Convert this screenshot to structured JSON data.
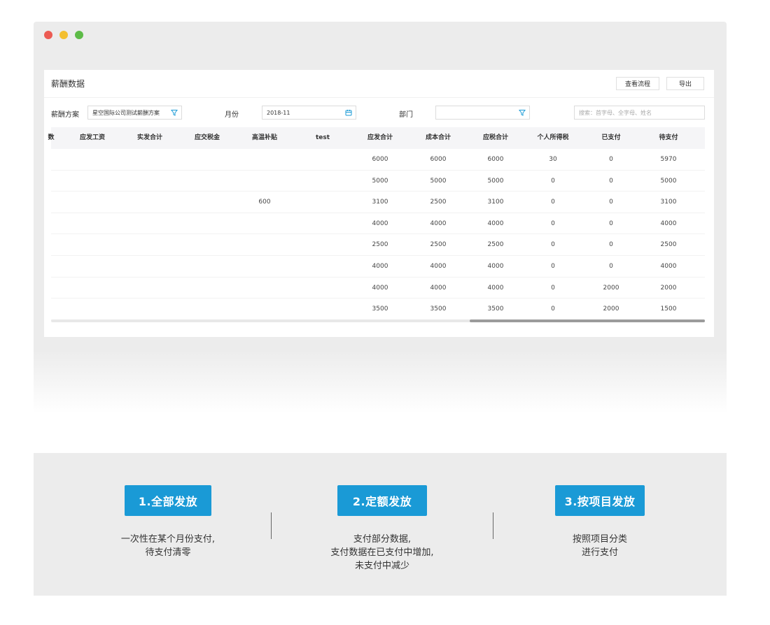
{
  "window": {
    "dots": [
      "#ec5b53",
      "#f3bf2f",
      "#5dbb47"
    ],
    "panel": {
      "title": "薪酬数据",
      "buttons": {
        "view_flow": "查看流程",
        "export": "导出"
      },
      "filters": {
        "plan_label": "薪酬方案",
        "plan_value": "星空国际公司测试薪酬方案",
        "month_label": "月份",
        "month_value": "2018-11",
        "dept_label": "部门",
        "dept_value": "",
        "search_placeholder": "搜索：首字母、全字母、姓名"
      },
      "table": {
        "columns": [
          "数",
          "应发工资",
          "实发合计",
          "应交税金",
          "高温补贴",
          "test",
          "应发合计",
          "成本合计",
          "应税合计",
          "个人所得税",
          "已支付",
          "待支付"
        ],
        "rows": [
          [
            "",
            "",
            "",
            "",
            "",
            "",
            "6000",
            "6000",
            "6000",
            "30",
            "0",
            "5970"
          ],
          [
            "",
            "",
            "",
            "",
            "",
            "",
            "5000",
            "5000",
            "5000",
            "0",
            "0",
            "5000"
          ],
          [
            "",
            "",
            "",
            "",
            "600",
            "",
            "3100",
            "2500",
            "3100",
            "0",
            "0",
            "3100"
          ],
          [
            "",
            "",
            "",
            "",
            "",
            "",
            "4000",
            "4000",
            "4000",
            "0",
            "0",
            "4000"
          ],
          [
            "",
            "",
            "",
            "",
            "",
            "",
            "2500",
            "2500",
            "2500",
            "0",
            "0",
            "2500"
          ],
          [
            "",
            "",
            "",
            "",
            "",
            "",
            "4000",
            "4000",
            "4000",
            "0",
            "0",
            "4000"
          ],
          [
            "",
            "",
            "",
            "",
            "",
            "",
            "4000",
            "4000",
            "4000",
            "0",
            "2000",
            "2000"
          ],
          [
            "",
            "",
            "",
            "",
            "",
            "",
            "3500",
            "3500",
            "3500",
            "0",
            "2000",
            "1500"
          ]
        ]
      }
    }
  },
  "features": [
    {
      "badge": "1.全部发放",
      "lines": [
        "一次性在某个月份支付,",
        "待支付清零"
      ]
    },
    {
      "badge": "2.定额发放",
      "lines": [
        "支付部分数据,",
        "支付数据在已支付中增加,",
        "未支付中减少"
      ]
    },
    {
      "badge": "3.按项目发放",
      "lines": [
        "按照项目分类",
        "进行支付"
      ]
    }
  ],
  "accent_color": "#1a9ad6"
}
